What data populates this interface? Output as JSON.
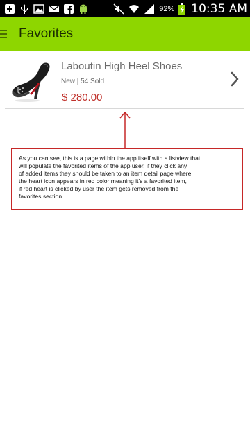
{
  "status_bar": {
    "battery_percent": "92%",
    "time": "10:35 AM",
    "icons": [
      "add-box-icon",
      "usb-icon",
      "image-icon",
      "email-icon",
      "facebook-icon",
      "android-icon",
      "mute-icon",
      "wifi-icon",
      "signal-icon",
      "battery-charging-icon"
    ]
  },
  "action_bar": {
    "title": "Favorites",
    "background_color": "#8ed600"
  },
  "favorites": {
    "items": [
      {
        "title": "Laboutin High Heel Shoes",
        "meta": "New | 54 Sold",
        "price": "$ 280.00",
        "image_icon": "high-heel-shoe-icon"
      }
    ]
  },
  "annotation": {
    "lines": [
      "As you can see, this is a page within the app itself with a listview that",
      "will populate the favorited items of the app user, if they click any",
      "of added items they should be taken to an item detail page where",
      "the heart icon appears in red color meaning it's a favorited item,",
      "if red heart is clicked by user the item gets removed from the",
      "favorites section."
    ],
    "border_color": "#c62828"
  }
}
